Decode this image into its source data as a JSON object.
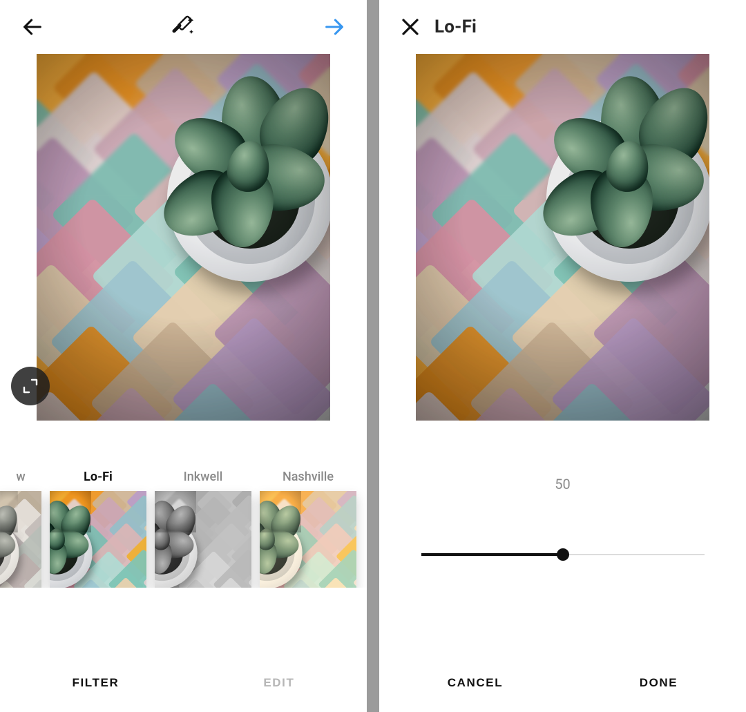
{
  "left": {
    "tabs": {
      "filter": "FILTER",
      "edit": "EDIT",
      "active": "filter"
    },
    "filters": [
      {
        "id": "willow",
        "label": "w",
        "selected": false,
        "thumbClass": "thumb-willow",
        "partial": true
      },
      {
        "id": "lofi",
        "label": "Lo-Fi",
        "selected": true,
        "thumbClass": "thumb-lofi"
      },
      {
        "id": "inkwell",
        "label": "Inkwell",
        "selected": false,
        "thumbClass": "thumb-gray"
      },
      {
        "id": "nashville",
        "label": "Nashville",
        "selected": false,
        "thumbClass": "thumb-nash"
      }
    ]
  },
  "right": {
    "title": "Lo-Fi",
    "slider": {
      "value": 50,
      "min": 0,
      "max": 100
    },
    "buttons": {
      "cancel": "CANCEL",
      "done": "DONE"
    }
  },
  "icons": {
    "back": "back-arrow-icon",
    "next": "next-arrow-icon",
    "wand": "magic-wand-icon",
    "close": "close-icon",
    "expand": "expand-icon"
  },
  "colors": {
    "accent": "#3897f0"
  }
}
